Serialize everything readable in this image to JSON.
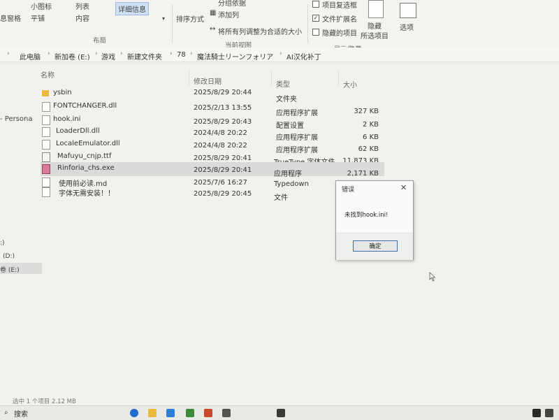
{
  "ribbon": {
    "layout_items": [
      "小图标",
      "平铺",
      "列表",
      "内容",
      "详细信息"
    ],
    "preview_pane_label": "息窗格",
    "layout_group": "布局",
    "sort_label": "排序方式",
    "group_by_label": "分组依据",
    "add_column_label": "添加列",
    "fit_columns_label": "将所有列调整为合适的大小",
    "current_view_group": "当前视图",
    "item_checkbox_label": "项目复选框",
    "file_ext_label": "文件扩展名",
    "hidden_items_label": "隐藏的项目",
    "hide_selected_label": "隐藏",
    "hide_selected_label2": "所选项目",
    "options_label": "选项",
    "show_hide_group": "显示/隐藏"
  },
  "address": {
    "crumbs": [
      "此电脑",
      "新加卷 (E:)",
      "游戏",
      "新建文件夹",
      "78",
      "魔法騎士リーンフォリア",
      "AI汉化补丁"
    ]
  },
  "columns": {
    "name": "名称",
    "modified": "修改日期",
    "type": "类型",
    "size": "大小"
  },
  "files": [
    {
      "name": "ysbin",
      "modified": "2025/8/29 20:44",
      "type": "文件夹",
      "size": ""
    },
    {
      "name": "FONTCHANGER.dll",
      "modified": "2025/2/13 13:55",
      "type": "应用程序扩展",
      "size": "327 KB"
    },
    {
      "name": "hook.ini",
      "modified": "2025/8/29 20:43",
      "type": "配置设置",
      "size": "2 KB"
    },
    {
      "name": "LoaderDll.dll",
      "modified": "2024/4/8 20:22",
      "type": "应用程序扩展",
      "size": "6 KB"
    },
    {
      "name": "LocaleEmulator.dll",
      "modified": "2024/4/8 20:22",
      "type": "应用程序扩展",
      "size": "62 KB"
    },
    {
      "name": "Mafuyu_cnjp.ttf",
      "modified": "2025/8/29 20:41",
      "type": "TrueType 字体文件",
      "size": "11,873 KB"
    },
    {
      "name": "Rinforia_chs.exe",
      "modified": "2025/8/29 20:41",
      "type": "应用程序",
      "size": "2,171 KB"
    },
    {
      "name": "使用前必读.md",
      "modified": "2025/7/6 16:27",
      "type": "Typedown",
      "size": ""
    },
    {
      "name": "字体无需安装！！",
      "modified": "2025/8/29 20:45",
      "type": "文件",
      "size": ""
    }
  ],
  "nav": {
    "persona": "- Persona",
    "drive_d": "(D:)",
    "drive_e": "卷 (E:)",
    "drive_c": ":)"
  },
  "dialog": {
    "title": "错误",
    "close": "✕",
    "message": "未找到hook.ini!",
    "ok": "确定"
  },
  "status": {
    "text": "选中 1 个项目  2.12 MB"
  },
  "taskbar": {
    "search": "搜索"
  },
  "colors": {
    "selected_row": "#dadad8",
    "folder": "#e8b93a",
    "dialog_button_border": "#3a6fb5"
  }
}
